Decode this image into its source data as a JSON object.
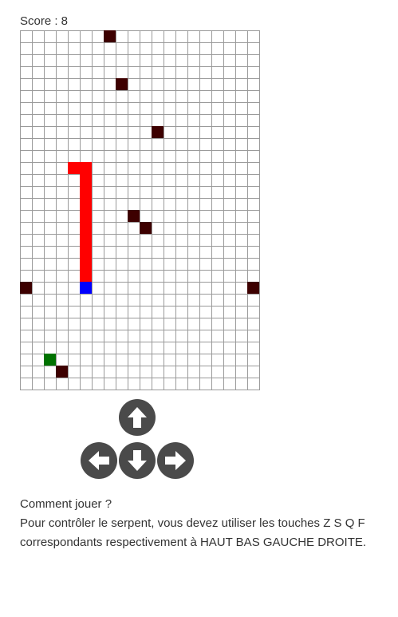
{
  "game": {
    "score_label": "Score : 8",
    "grid": {
      "cols": 20,
      "rows": 30
    },
    "colors": {
      "snake_body": "#ff0000",
      "snake_head": "#0000ff",
      "obstacle": "#3d0000",
      "food": "#007200",
      "grid_line": "#9a9a9a"
    },
    "snake_body": [
      [
        4,
        11
      ],
      [
        5,
        11
      ],
      [
        5,
        12
      ],
      [
        5,
        13
      ],
      [
        5,
        14
      ],
      [
        5,
        15
      ],
      [
        5,
        16
      ],
      [
        5,
        17
      ],
      [
        5,
        18
      ],
      [
        5,
        19
      ],
      [
        5,
        20
      ]
    ],
    "snake_head": [
      5,
      21
    ],
    "obstacles": [
      [
        7,
        0
      ],
      [
        8,
        4
      ],
      [
        11,
        8
      ],
      [
        9,
        15
      ],
      [
        10,
        16
      ],
      [
        0,
        21
      ],
      [
        19,
        21
      ],
      [
        3,
        28
      ]
    ],
    "food": [
      [
        2,
        27
      ]
    ]
  },
  "controls": {
    "up": "arrow-up-icon",
    "down": "arrow-down-icon",
    "left": "arrow-left-icon",
    "right": "arrow-right-icon",
    "button_color": "#4a4a4a"
  },
  "help": {
    "title": "Comment jouer ?",
    "line1": "Pour contrôler le serpent, vous devez utiliser les touches Z S Q F",
    "line2": "correspondants respectivement à HAUT BAS GAUCHE DROITE."
  }
}
